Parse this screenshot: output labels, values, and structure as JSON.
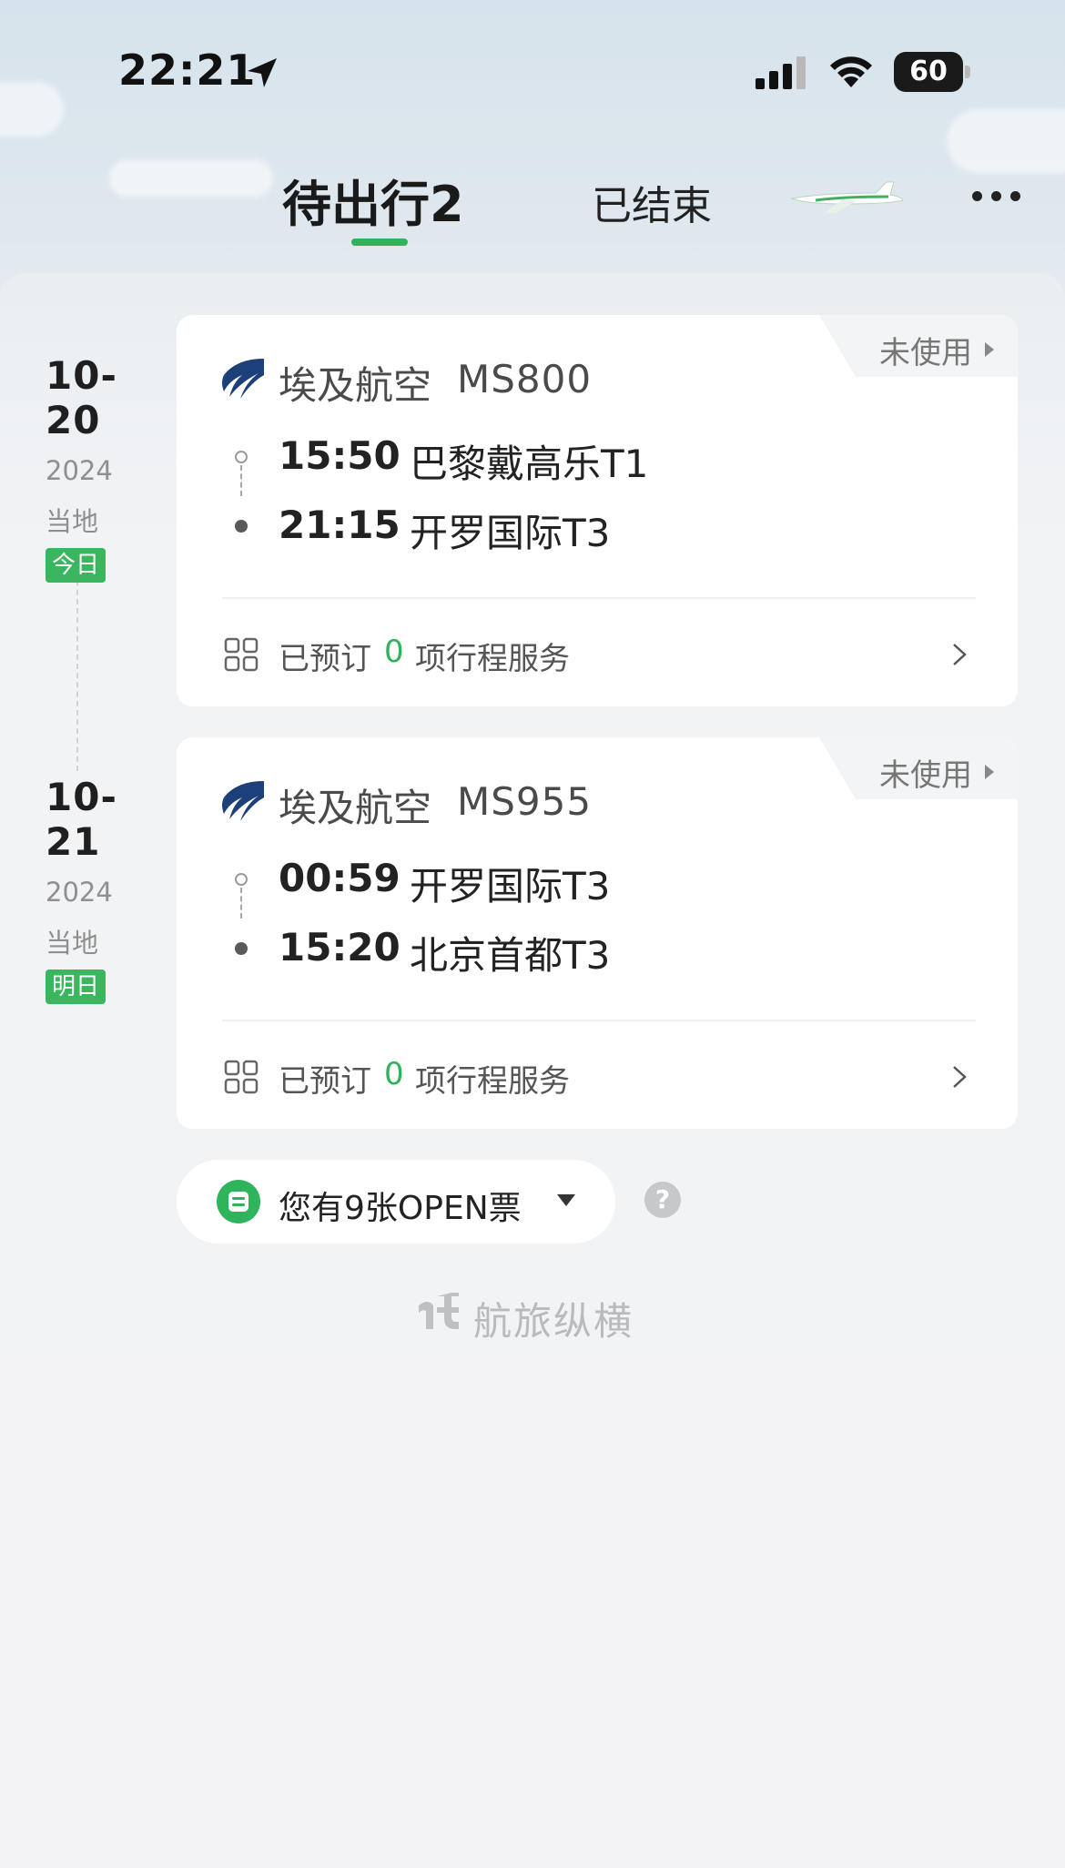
{
  "status_bar": {
    "time": "22:21",
    "battery": "60"
  },
  "tabs": {
    "upcoming_label": "待出行2",
    "ended_label": "已结束"
  },
  "trips": [
    {
      "date": "10-20",
      "year": "2024",
      "local": "当地",
      "day_badge": "今日",
      "status": "未使用",
      "airline": "埃及航空",
      "flight": "MS800",
      "depart_time": "15:50",
      "depart_airport": "巴黎戴高乐T1",
      "arrive_time": "21:15",
      "arrive_airport": "开罗国际T3",
      "services_prefix": "已预订",
      "services_count": "0",
      "services_suffix": "项行程服务"
    },
    {
      "date": "10-21",
      "year": "2024",
      "local": "当地",
      "day_badge": "明日",
      "status": "未使用",
      "airline": "埃及航空",
      "flight": "MS955",
      "depart_time": "00:59",
      "depart_airport": "开罗国际T3",
      "arrive_time": "15:20",
      "arrive_airport": "北京首都T3",
      "services_prefix": "已预订",
      "services_count": "0",
      "services_suffix": "项行程服务"
    }
  ],
  "open_tickets": {
    "label": "您有9张OPEN票",
    "help": "?"
  },
  "brand": {
    "name": "航旅纵横"
  },
  "colors": {
    "accent": "#2fb45b",
    "badge": "#3bb55e",
    "airline_blue": "#1d3f7a"
  },
  "icons": [
    "location-arrow-icon",
    "signal-icon",
    "wifi-icon",
    "battery-icon",
    "plane-icon",
    "more-icon",
    "egyptair-logo-icon",
    "grid-icon",
    "chevron-right-icon",
    "ticket-icon",
    "caret-down-icon",
    "help-icon"
  ]
}
